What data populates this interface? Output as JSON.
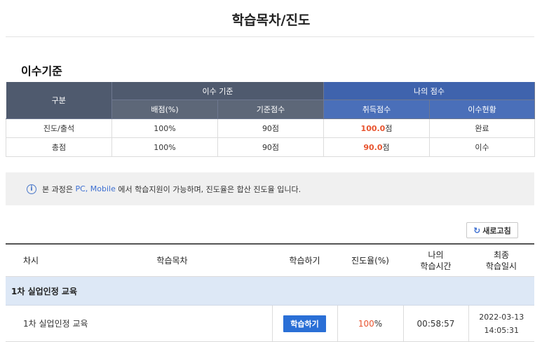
{
  "page": {
    "title": "학습목차/진도"
  },
  "criteria": {
    "section_title": "이수기준",
    "headers": {
      "category": "구분",
      "criteria_group": "이수 기준",
      "my_score_group": "나의 점수",
      "allotment": "배점(%)",
      "base_score": "기준점수",
      "earned_score": "취득점수",
      "completion_status": "이수현황"
    },
    "rows": [
      {
        "category": "진도/출석",
        "allotment": "100%",
        "base_score": "90점",
        "earned_num": "100.0",
        "earned_unit": "점",
        "status": "완료"
      },
      {
        "category": "총점",
        "allotment": "100%",
        "base_score": "90점",
        "earned_num": "90.0",
        "earned_unit": "점",
        "status": "이수"
      }
    ]
  },
  "notice": {
    "icon": "info-icon",
    "prefix": "본 과정은 ",
    "platforms": "PC, Mobile",
    "suffix": " 에서 학습지원이 가능하며, 진도율은 합산 진도율 입니다."
  },
  "refresh": {
    "icon": "refresh-icon",
    "label": "새로고침"
  },
  "curriculum": {
    "headers": {
      "session": "차시",
      "contents": "학습목차",
      "study": "학습하기",
      "progress": "진도율(%)",
      "my_time_line1": "나의",
      "my_time_line2": "학습시간",
      "last_line1": "최종",
      "last_line2": "학습일시"
    },
    "group": "1차 실업인정 교육",
    "items": [
      {
        "name": "1차 실업인정 교육",
        "button": "학습하기",
        "progress_num": "100",
        "progress_unit": "%",
        "time": "00:58:57",
        "date": "2022-03-13",
        "clock": "14:05:31"
      }
    ]
  }
}
